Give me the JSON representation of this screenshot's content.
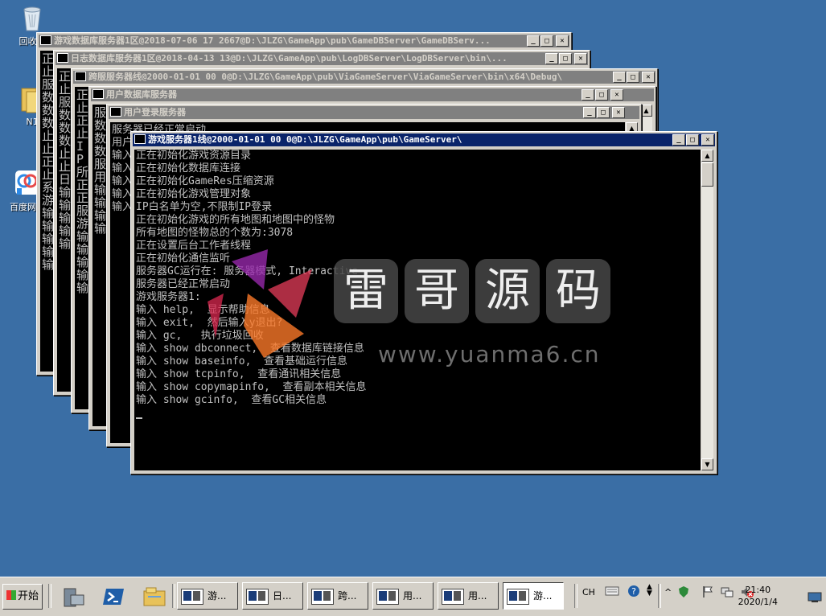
{
  "desktop": {
    "icons": [
      {
        "label": "回收站"
      },
      {
        "label": "N1"
      },
      {
        "label": "百度网盘"
      }
    ]
  },
  "windows": [
    {
      "title": "游戏数据库服务器1区@2018-07-06 17 2667@D:\\JLZG\\GameApp\\pub\\GameDBServer\\GameDBServ...",
      "lines": [
        "正止服数数数止止正止系游输输输输输"
      ]
    },
    {
      "title": "日志数据库服务器1区@2018-04-13 13@D:\\JLZG\\GameApp\\pub\\LogDBServer\\LogDBServer\\bin\\...",
      "lines": [
        "正止服数数数止止日输输输输输"
      ]
    },
    {
      "title": "跨服服务器线@2000-01-01 00 0@D:\\JLZG\\GameApp\\pub\\ViaGameServer\\ViaGameServer\\bin\\x64\\Debug\\",
      "lines": [
        "正止正止IP所正正服游输输输输输"
      ]
    },
    {
      "title": "用户数据库服务器",
      "lines": [
        "服数数数服用输输输输"
      ]
    },
    {
      "title": "用户登录服务器",
      "lines": [
        "服务器已经正常启动",
        "用户",
        "输入",
        "输入",
        "输入",
        "输入",
        "输入"
      ]
    },
    {
      "title": "游戏服务器1线@2000-01-01 00 0@D:\\JLZG\\GameApp\\pub\\GameServer\\",
      "lines": [
        "正在初始化游戏资源目录",
        "正在初始化数据库连接",
        "正在初始化GameRes压缩资源",
        "正在初始化游戏管理对象",
        "IP白名单为空,不限制IP登录",
        "正在初始化游戏的所有地图和地图中的怪物",
        "所有地图的怪物总的个数为:3078",
        "正在设置后台工作者线程",
        "正在初始化通信监听",
        "服务器GC运行在: 服务器模式, Interactive",
        "服务器已经正常启动",
        "游戏服务器1:",
        "输入 help,  显示帮助信息",
        "输入 exit,  然后输入y退出?",
        "输入 gc,   执行垃圾回收",
        "输入 show dbconnect,  查看数据库链接信息",
        "输入 show baseinfo,  查看基础运行信息",
        "输入 show tcpinfo,  查看通讯相关信息",
        "输入 show copymapinfo,  查看副本相关信息",
        "输入 show gcinfo,  查看GC相关信息"
      ]
    }
  ],
  "watermark": {
    "chars": [
      "雷",
      "哥",
      "源",
      "码"
    ],
    "url": "www.yuanma6.cn"
  },
  "taskbar": {
    "start_label": "开始",
    "tasks": [
      {
        "label": "游..."
      },
      {
        "label": "日..."
      },
      {
        "label": "跨..."
      },
      {
        "label": "用..."
      },
      {
        "label": "用..."
      },
      {
        "label": "游..."
      }
    ],
    "lang": "CH",
    "time": "21:40",
    "date": "2020/1/4"
  },
  "colors": {
    "desktop": "#3a6ea5",
    "active_title": "#0a246a",
    "inactive_title": "#808080",
    "console_bg": "#000000",
    "console_text": "#c0c0c0"
  }
}
